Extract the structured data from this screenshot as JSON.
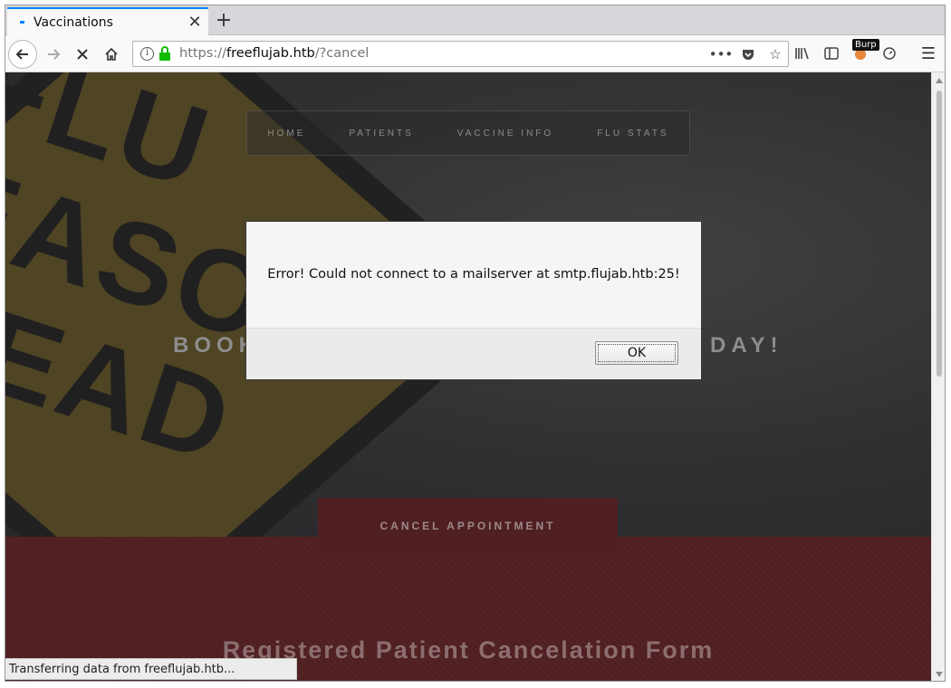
{
  "browser": {
    "tab_title": "Vaccinations",
    "url_prefix": "https://",
    "url_host": "freeflujab.htb",
    "url_path": "/?cancel",
    "burp_label": "Burp",
    "status_text": "Transferring data from freeflujab.htb..."
  },
  "page": {
    "nav": [
      "HOME",
      "PATIENTS",
      "VACCINE INFO",
      "FLU STATS"
    ],
    "sign_lines": [
      "FLU",
      "EASO",
      "HEAD"
    ],
    "hero_heading_left": "BOOK",
    "hero_heading_right": "DAY!",
    "cancel_tab_label": "CANCEL APPOINTMENT",
    "form_title": "Registered Patient Cancelation Form"
  },
  "dialog": {
    "message": "Error! Could not connect to a mailserver at smtp.flujab.htb:25!",
    "ok_label": "OK"
  },
  "colors": {
    "accent": "#0a84ff",
    "lock_green": "#12bc00",
    "lower_section": "#501f21"
  }
}
